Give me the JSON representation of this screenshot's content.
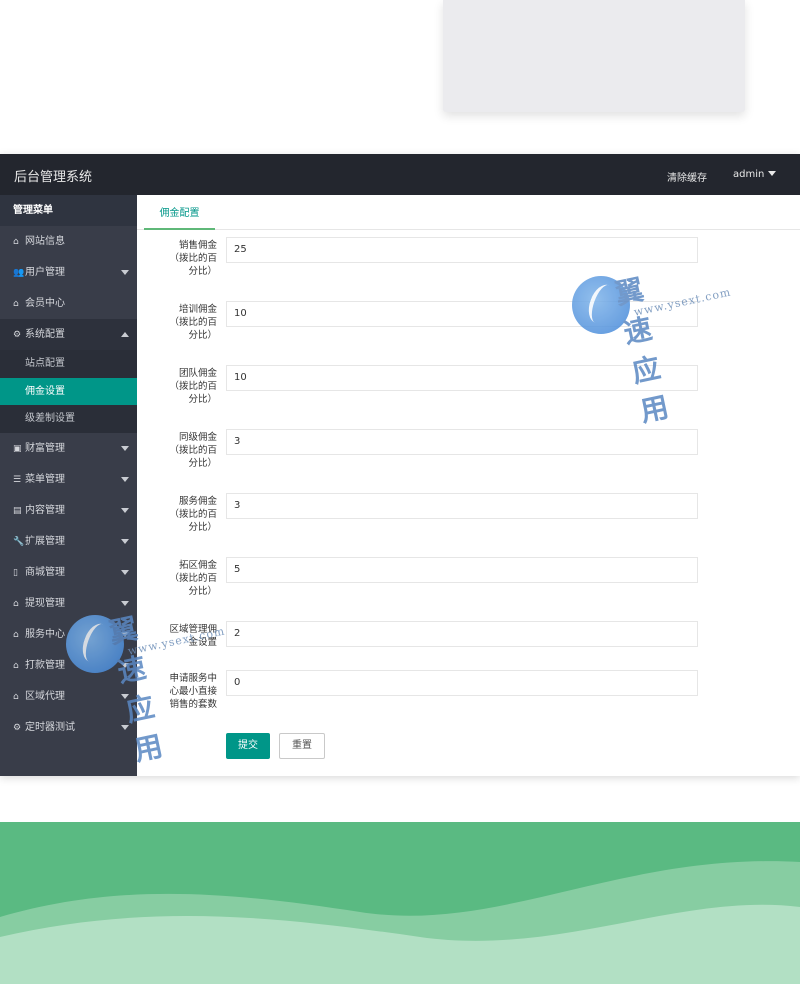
{
  "app": {
    "title": "后台管理系统"
  },
  "header": {
    "clear_cache": "清除缓存",
    "user": "admin"
  },
  "sidebar": {
    "heading": "管理菜单",
    "items": [
      {
        "label": "网站信息",
        "icon": "home-icon",
        "glyph": "⌂",
        "arrow": "none"
      },
      {
        "label": "用户管理",
        "icon": "users-icon",
        "glyph": "👥",
        "arrow": "down"
      },
      {
        "label": "会员中心",
        "icon": "home-icon",
        "glyph": "⌂",
        "arrow": "none"
      },
      {
        "label": "系统配置",
        "icon": "gears-icon",
        "glyph": "⚙",
        "arrow": "up",
        "open": true,
        "children": [
          {
            "label": "站点配置",
            "active": false
          },
          {
            "label": "佣金设置",
            "active": true
          },
          {
            "label": "级差制设置",
            "active": false
          }
        ]
      },
      {
        "label": "财富管理",
        "icon": "money-icon",
        "glyph": "▣",
        "arrow": "down"
      },
      {
        "label": "菜单管理",
        "icon": "bars-icon",
        "glyph": "☰",
        "arrow": "down"
      },
      {
        "label": "内容管理",
        "icon": "file-icon",
        "glyph": "▤",
        "arrow": "down"
      },
      {
        "label": "扩展管理",
        "icon": "wrench-icon",
        "glyph": "🔧",
        "arrow": "down"
      },
      {
        "label": "商城管理",
        "icon": "mobile-icon",
        "glyph": "▯",
        "arrow": "down"
      },
      {
        "label": "提现管理",
        "icon": "home-icon",
        "glyph": "⌂",
        "arrow": "down"
      },
      {
        "label": "服务中心",
        "icon": "home-icon",
        "glyph": "⌂",
        "arrow": "down"
      },
      {
        "label": "打款管理",
        "icon": "home-icon",
        "glyph": "⌂",
        "arrow": "down"
      },
      {
        "label": "区域代理",
        "icon": "home-icon",
        "glyph": "⌂",
        "arrow": "down"
      },
      {
        "label": "定时器测试",
        "icon": "gears-icon",
        "glyph": "⚙",
        "arrow": "down"
      }
    ]
  },
  "main": {
    "tab": "佣金配置",
    "fields": [
      {
        "label_lines": [
          "销售佣金",
          "（拨比的百",
          "分比）"
        ],
        "value": "25"
      },
      {
        "label_lines": [
          "培训佣金",
          "（拨比的百",
          "分比）"
        ],
        "value": "10"
      },
      {
        "label_lines": [
          "团队佣金",
          "（拨比的百",
          "分比）"
        ],
        "value": "10"
      },
      {
        "label_lines": [
          "同级佣金",
          "（拨比的百",
          "分比）"
        ],
        "value": "3"
      },
      {
        "label_lines": [
          "服务佣金",
          "（拨比的百",
          "分比）"
        ],
        "value": "3"
      },
      {
        "label_lines": [
          "拓区佣金",
          "（拨比的百",
          "分比）"
        ],
        "value": "5"
      },
      {
        "label_lines": [
          "区域管理佣",
          "金设置"
        ],
        "value": "2"
      },
      {
        "label_lines": [
          "申请服务中",
          "心最小直接",
          "销售的套数"
        ],
        "value": "0"
      }
    ],
    "submit": "提交",
    "reset": "重置"
  },
  "watermark": {
    "cn": "翼速应用",
    "en": "www.ysext.com"
  },
  "colors": {
    "accent": "#009688",
    "topbar": "#23262e",
    "sidebar": "#393d49",
    "wave": "#5aba82"
  }
}
